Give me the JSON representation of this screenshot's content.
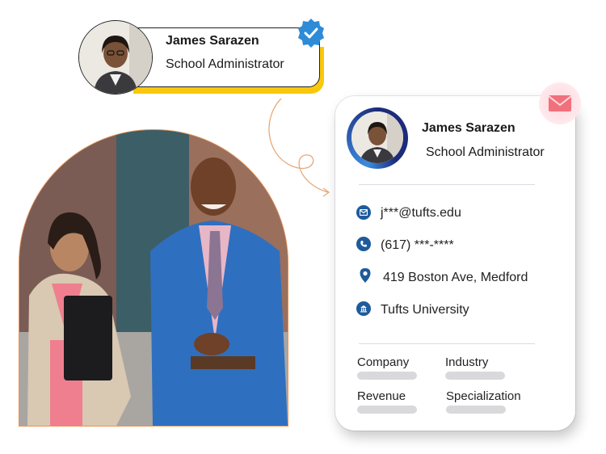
{
  "badge": {
    "name": "James Sarazen",
    "role": "School Administrator",
    "verified_icon": "verified-check-icon"
  },
  "card": {
    "name": "James Sarazen",
    "role": "School Administrator",
    "mail_icon": "envelope-icon",
    "contacts": [
      {
        "icon": "email-icon",
        "text": "j***@tufts.edu"
      },
      {
        "icon": "phone-icon",
        "text": "(617) ***-****"
      },
      {
        "icon": "location-icon",
        "text": "419 Boston Ave, Medford"
      },
      {
        "icon": "building-icon",
        "text": "Tufts University"
      }
    ],
    "fields": [
      {
        "label": "Company"
      },
      {
        "label": "Industry"
      },
      {
        "label": "Revenue"
      },
      {
        "label": "Specialization"
      }
    ]
  },
  "colors": {
    "accent_yellow": "#f9c80e",
    "icon_blue": "#1e5b9b",
    "verified_blue": "#2e8bd8",
    "arch_border": "#e5955a"
  }
}
